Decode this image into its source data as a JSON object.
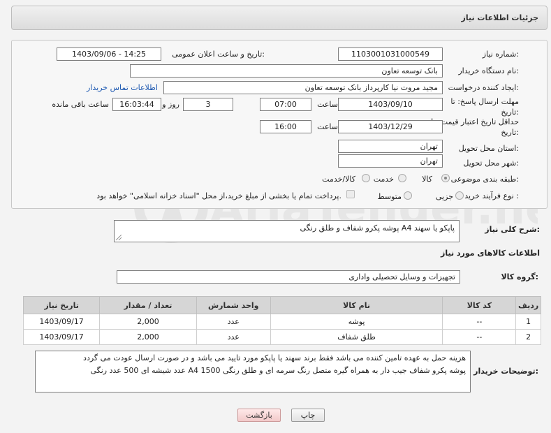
{
  "header": {
    "title": "جزئیات اطلاعات نیاز"
  },
  "form": {
    "need_number_label": "شماره نیاز:",
    "need_number": "1103001031000549",
    "announce_label": "تاریخ و ساعت اعلان عمومی:",
    "announce_value": "1403/09/06 - 14:25",
    "buyer_org_label": "نام دستگاه خریدار:",
    "buyer_org": "بانک توسعه تعاون",
    "requester_label": "ایجاد کننده درخواست:",
    "requester": "مجید مروت نیا کارپرداز بانک توسعه تعاون",
    "buyer_contact_link": "اطلاعات تماس خریدار",
    "deadline_label": "مهلت ارسال پاسخ: تا تاریخ:",
    "deadline_date": "1403/09/10",
    "time_label": "ساعت",
    "deadline_time": "07:00",
    "days_value": "3",
    "days_label": "روز و",
    "remaining_time": "16:03:44",
    "remaining_label": "ساعت باقی مانده",
    "validity_label": "حداقل تاریخ اعتبار قیمت: تا تاریخ:",
    "validity_date": "1403/12/29",
    "validity_time": "16:00",
    "province_label": "استان محل تحویل:",
    "province": "تهران",
    "city_label": "شهر محل تحویل:",
    "city": "تهران",
    "category_label": "طبقه بندی موضوعی:",
    "category_options": [
      "کالا",
      "خدمت",
      "کالا/خدمت"
    ],
    "process_label": "نوع فرآیند خرید :",
    "process_options": [
      "جزیی",
      "متوسط"
    ],
    "payment_note": "پرداخت تمام یا بخشی از مبلغ خرید،از محل \"اسناد خزانه اسلامی\" خواهد بود."
  },
  "summary": {
    "label": "شرح کلی نیاز:",
    "text": "پوشه پکرو شفاف و طلق رنگی A4 پاپکو یا سهند"
  },
  "goods": {
    "section_title": "اطلاعات کالاهای مورد نیاز",
    "group_label": "گروه کالا:",
    "group_value": "تجهیزات و وسایل تحصیلی واداری",
    "columns": [
      "ردیف",
      "کد کالا",
      "نام کالا",
      "واحد شمارش",
      "تعداد / مقدار",
      "تاریخ نیاز"
    ],
    "rows": [
      [
        "1",
        "--",
        "پوشه",
        "عدد",
        "2,000",
        "1403/09/17"
      ],
      [
        "2",
        "--",
        "طلق شفاف",
        "عدد",
        "2,000",
        "1403/09/17"
      ]
    ]
  },
  "buyer_notes": {
    "label": "توضیحات خریدار:",
    "line1": "هزینه حمل به عهده تامین کننده می باشد فقط برند سهند یا پاپکو مورد تایید می باشد و در صورت ارسال عودت می گردد",
    "line2": "پوشه پکرو شفاف جیب دار به همراه گیره متصل رنگ سرمه ای و طلق رنگی 1500 A4 عدد شیشه ای 500 عدد رنگی"
  },
  "buttons": {
    "print": "چاپ",
    "back": "بازگشت"
  },
  "watermark": {
    "text": "AriaTender.neT"
  },
  "colors": {
    "link": "#1a56b0",
    "watermark": "#e6e6e6"
  }
}
